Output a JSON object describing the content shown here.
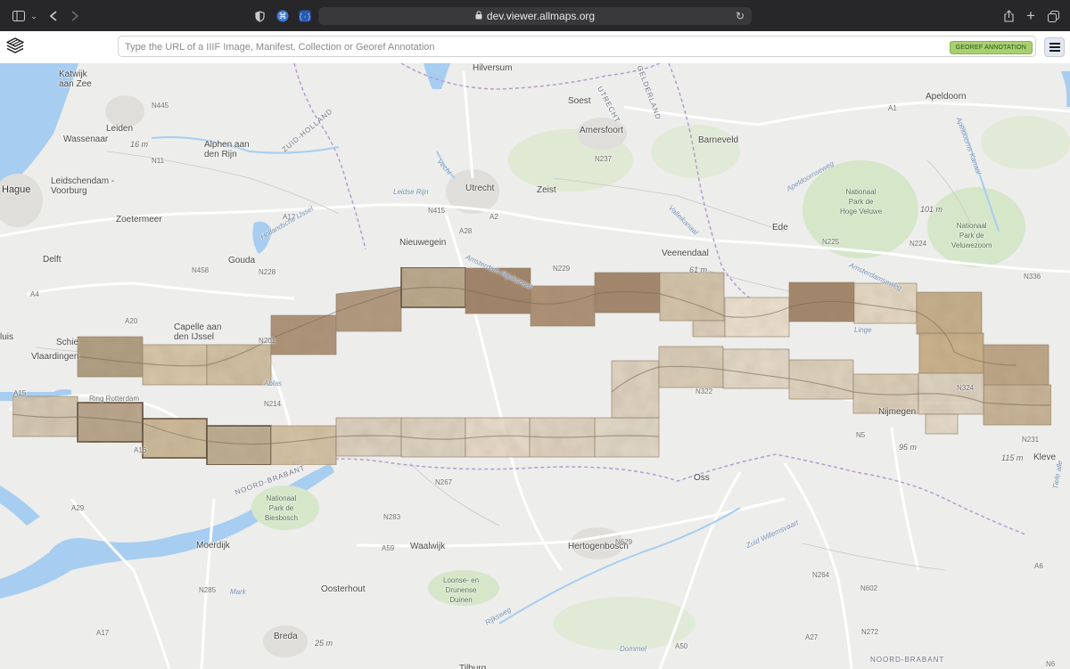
{
  "browser": {
    "url": "dev.viewer.allmaps.org",
    "icons": [
      "sidebar-icon",
      "chevron-down-icon",
      "back-icon",
      "forward-icon",
      "shield-icon",
      "extension-icon",
      "json-icon",
      "lock-icon",
      "reload-icon",
      "share-icon",
      "new-tab-icon",
      "tabs-overview-icon"
    ]
  },
  "app": {
    "search_placeholder": "Type the URL of a IIIF Image, Manifest, Collection or Georef Annotation",
    "badge": "GEOREF ANNOTATION",
    "accent_color": "#a9cf6e"
  },
  "map": {
    "places": [
      {
        "name": "Katwijk\naan Zee"
      },
      {
        "name": "Leiden"
      },
      {
        "name": "Wassenaar"
      },
      {
        "name": "Alphen aan\nden Rijn"
      },
      {
        "name": "Leidschendam -\nVoorburg"
      },
      {
        "name": "Hague"
      },
      {
        "name": "Zoetermeer"
      },
      {
        "name": "Delft"
      },
      {
        "name": "Gouda"
      },
      {
        "name": "Capelle aan\nden IJssel"
      },
      {
        "name": "luis"
      },
      {
        "name": "Schie"
      },
      {
        "name": "Vlaardingen"
      },
      {
        "name": "Utrecht"
      },
      {
        "name": "Zeist"
      },
      {
        "name": "Soest"
      },
      {
        "name": "Amersfoort"
      },
      {
        "name": "Barneveld"
      },
      {
        "name": "Apeldoorn"
      },
      {
        "name": "Nieuwegein"
      },
      {
        "name": "Veenendaal"
      },
      {
        "name": "Ede"
      },
      {
        "name": "Nijmegen"
      },
      {
        "name": "Kleve"
      },
      {
        "name": "Oss"
      },
      {
        "name": "Hertogenbosch"
      },
      {
        "name": "Waalwijk"
      },
      {
        "name": "Moerdijk"
      },
      {
        "name": "Oosterhout"
      },
      {
        "name": "Breda"
      },
      {
        "name": "Tilburg"
      },
      {
        "name": "Hilversum"
      }
    ],
    "parks": [
      {
        "name": "Nationaal\nPark de\nHoge Veluwe"
      },
      {
        "name": "Nationaal\nPark de\nVeluwezoom"
      },
      {
        "name": "Nationaal\nPark de\nBiesbosch"
      },
      {
        "name": "Loonse- en\nDrunense\nDuinen"
      }
    ],
    "regions": [
      "ZUID-HOLLAND",
      "UTRECHT",
      "GELDERLAND",
      "NOORD-BRABANT",
      "NOORD-BRABANT"
    ],
    "roads": [
      "N445",
      "N11",
      "A12",
      "A20",
      "A15",
      "A29",
      "A16",
      "A17",
      "A59",
      "A27",
      "A50",
      "A1",
      "N225",
      "N237",
      "N229",
      "N228",
      "N214",
      "N267",
      "N283",
      "N285",
      "N264",
      "N602",
      "N272",
      "N336",
      "N322",
      "N458",
      "N415",
      "N224",
      "A28",
      "N201",
      "A4",
      "Ring Rotterdam",
      "A2",
      "N324",
      "N231",
      "A6",
      "N5",
      "N629",
      "N6"
    ],
    "water": [
      "Leidse Rijn",
      "Vecht",
      "Hollandsche IJssel",
      "Ablas",
      "Linge",
      "Amsterdam-Rijnkanaal",
      "Valleikanaal",
      "Apeldoorns Kanaal",
      "Zuid Willemsvaart",
      "Dommel",
      "Mark",
      "Rijksweg",
      "Apeldoornseweg",
      "Amsterdamseweg",
      "Tiefe alle"
    ],
    "elevations": [
      "16 m",
      "61 m",
      "101 m",
      "95 m",
      "115 m",
      "25 m"
    ],
    "overlay_count": 37
  }
}
